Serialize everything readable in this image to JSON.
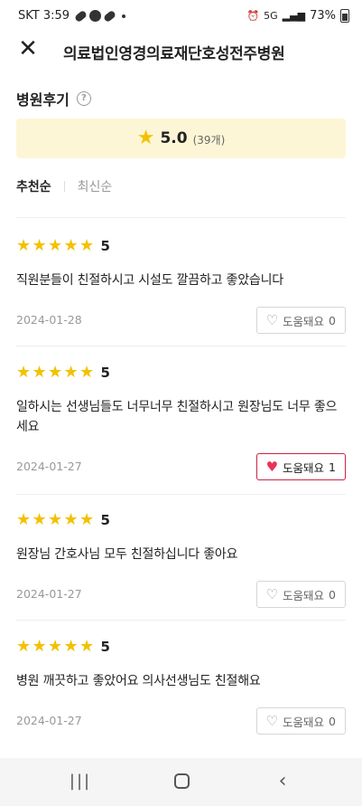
{
  "status_bar": {
    "carrier_time": "SKT 3:59",
    "network": "5G",
    "battery": "73%"
  },
  "header": {
    "close_icon": "close-icon",
    "title": "의료법인영경의료재단호성전주병원"
  },
  "section": {
    "title": "병원후기",
    "help_icon": "?"
  },
  "rating": {
    "star": "★",
    "score": "5.0",
    "count": "(39개)"
  },
  "sort": {
    "recommended": "추천순",
    "latest": "최신순"
  },
  "reviews": [
    {
      "stars": 5,
      "score": "5",
      "text": "직원분들이 친절하시고 시설도 깔끔하고 좋았습니다",
      "date": "2024-01-28",
      "helpful_label": "도움돼요",
      "helpful_count": "0",
      "helpful_active": false
    },
    {
      "stars": 5,
      "score": "5",
      "text": "일하시는 선생님들도 너무너무 친절하시고 원장님도 너무 좋으세요",
      "date": "2024-01-27",
      "helpful_label": "도움돼요",
      "helpful_count": "1",
      "helpful_active": true
    },
    {
      "stars": 5,
      "score": "5",
      "text": "원장님 간호사님 모두 친절하십니다 좋아요",
      "date": "2024-01-27",
      "helpful_label": "도움돼요",
      "helpful_count": "0",
      "helpful_active": false
    },
    {
      "stars": 5,
      "score": "5",
      "text": "병원 깨끗하고 좋았어요 의사선생님도 친절해요",
      "date": "2024-01-27",
      "helpful_label": "도움돼요",
      "helpful_count": "0",
      "helpful_active": false
    }
  ],
  "colors": {
    "star": "#f3c100",
    "rating_bg": "#fdf6d6",
    "heart_active": "#e8335a",
    "active_border": "#cc2444"
  }
}
